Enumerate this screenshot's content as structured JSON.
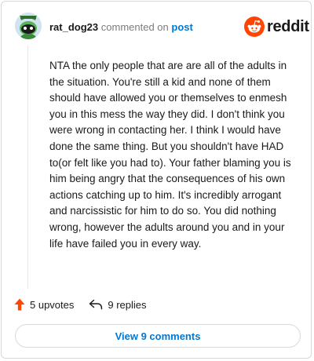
{
  "comment": {
    "username": "rat_dog23",
    "action_text": "commented on",
    "post_link_label": "post",
    "body": "NTA the only people that are are all of the adults in the situation. You're still a kid and none of them should have allowed you or themselves to enmesh you in this mess the way they did. I don't think you were wrong in contacting her. I think I would have done the same thing. But you shouldn't have HAD to(or felt like you had to). Your father blaming you is him being angry that the consequences of his own actions catching up to him. It's incredibly arrogant and narcissistic for him to do so. You did nothing wrong, however the adults around you and in your life have failed you in every way.",
    "upvotes_label": "5 upvotes",
    "replies_label": "9 replies"
  },
  "brand": {
    "wordmark": "reddit",
    "accent_color": "#ff4500"
  },
  "footer": {
    "view_comments_label": "View 9 comments"
  },
  "colors": {
    "link": "#0079d3",
    "text": "#1a1a1b",
    "muted": "#7c7c7c",
    "upvote": "#ff4500",
    "border": "#d6d9dc"
  },
  "icons": {
    "avatar": "snoo-avatar",
    "logo": "reddit-logo-icon",
    "upvote": "upvote-arrow-icon",
    "reply": "reply-arrow-icon"
  }
}
